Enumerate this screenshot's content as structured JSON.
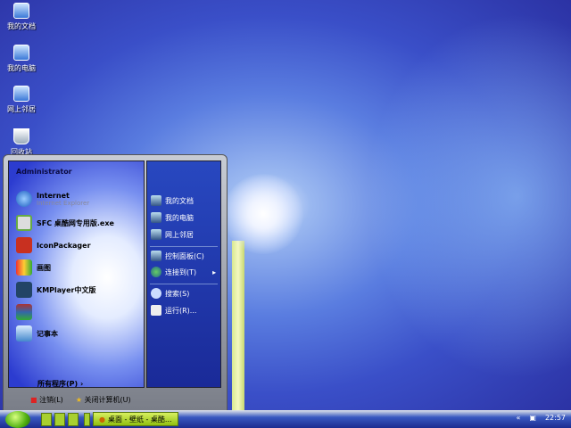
{
  "desktop_icons": [
    {
      "label": "我的文档"
    },
    {
      "label": "我的电脑"
    },
    {
      "label": "网上邻居"
    },
    {
      "label": "回收站"
    }
  ],
  "start_menu": {
    "user": "Administrator",
    "left_items": [
      {
        "label": "Internet",
        "sublabel": "Internet Explorer",
        "icon": "ie-icon"
      },
      {
        "label": "SFC 桌酷网专用版.exe",
        "icon": "sfc-icon"
      },
      {
        "label": "IconPackager",
        "icon": "iconpackager-icon"
      },
      {
        "label": "画图",
        "icon": "paint-icon"
      },
      {
        "label": "KMPlayer中文版",
        "icon": "kmplayer-icon"
      },
      {
        "label": "",
        "icon": "winrar-icon"
      },
      {
        "label": "记事本",
        "icon": "notepad-icon"
      }
    ],
    "all_programs": "所有程序(P)",
    "right_items": [
      {
        "label": "我的文档"
      },
      {
        "label": "我的电脑"
      },
      {
        "label": "网上邻居"
      },
      {
        "label": "控制面板(C)"
      },
      {
        "label": "连接到(T)"
      },
      {
        "label": "搜索(S)"
      },
      {
        "label": "运行(R)..."
      }
    ],
    "logoff": "注销(L)",
    "shutdown": "关闭计算机(U)"
  },
  "taskbar": {
    "task": "桌面 - 壁纸 - 桌酷...",
    "clock": "22:57"
  }
}
